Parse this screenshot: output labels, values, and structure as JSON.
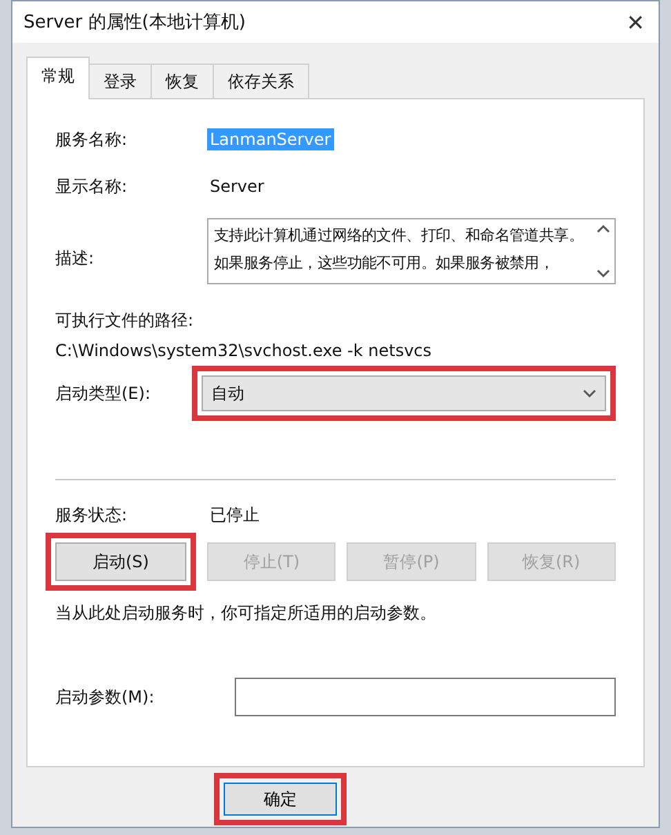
{
  "window": {
    "title": "Server 的属性(本地计算机)",
    "close": "✕"
  },
  "tabs": [
    {
      "label": "常规",
      "selected": true
    },
    {
      "label": "登录",
      "selected": false
    },
    {
      "label": "恢复",
      "selected": false
    },
    {
      "label": "依存关系",
      "selected": false
    }
  ],
  "service_name": {
    "label": "服务名称:",
    "value": "LanmanServer",
    "selected": true
  },
  "display_name": {
    "label": "显示名称:",
    "value": "Server"
  },
  "description": {
    "label": "描述:",
    "value": "支持此计算机通过网络的文件、打印、和命名管道共享。如果服务停止，这些功能不可用。如果服务被禁用，"
  },
  "executable_path": {
    "label": "可执行文件的路径:",
    "value": "C:\\Windows\\system32\\svchost.exe -k netsvcs"
  },
  "startup_type": {
    "label": "启动类型(E):",
    "value": "自动",
    "highlighted": true
  },
  "service_status": {
    "label": "服务状态:",
    "value": "已停止"
  },
  "service_buttons": [
    {
      "label": "启动(S)",
      "disabled": false,
      "highlighted": true
    },
    {
      "label": "停止(T)",
      "disabled": true,
      "highlighted": false
    },
    {
      "label": "暂停(P)",
      "disabled": true,
      "highlighted": false
    },
    {
      "label": "恢复(R)",
      "disabled": true,
      "highlighted": false
    }
  ],
  "note": "当从此处启动服务时，你可指定所适用的启动参数。",
  "start_parameters": {
    "label": "启动参数(M):"
  },
  "dialog_buttons": [
    {
      "label": "确定",
      "highlighted": true
    }
  ]
}
